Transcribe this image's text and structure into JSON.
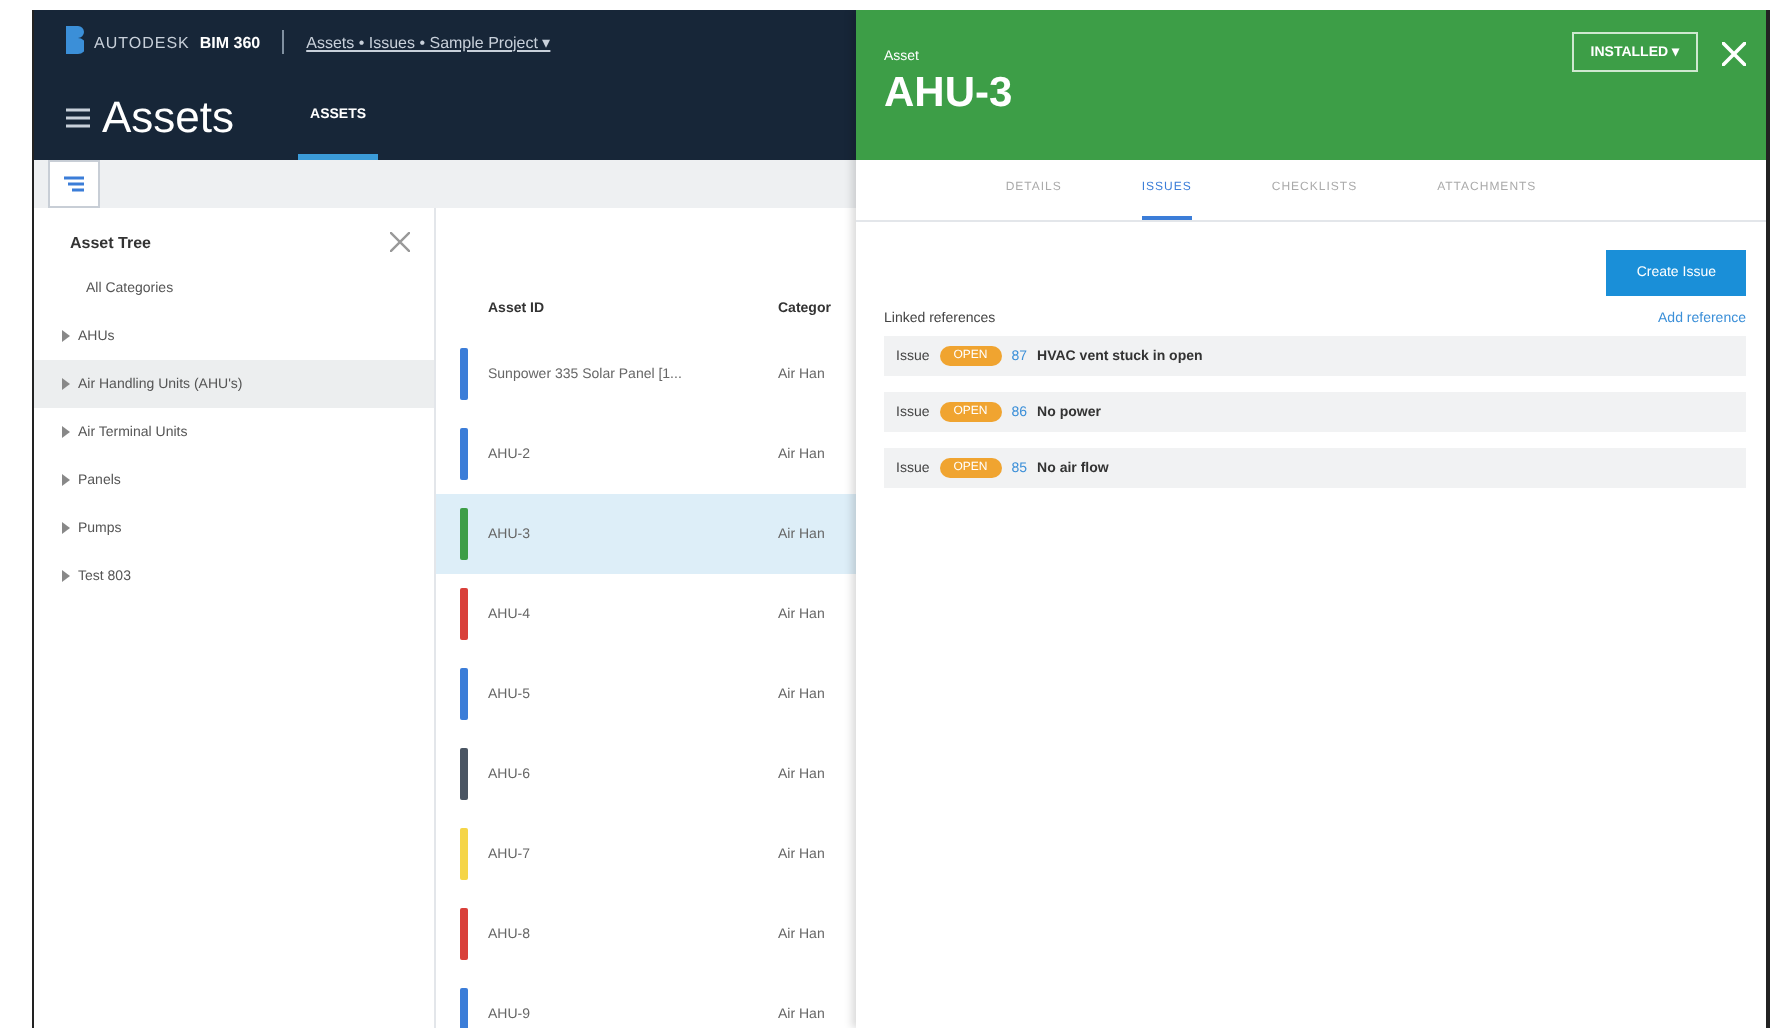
{
  "brand": {
    "logo": "AUTODESK",
    "product": "BIM 360"
  },
  "breadcrumb": "Assets • Issues • Sample Project ▾",
  "page_title": "Assets",
  "nav_tabs": [
    {
      "label": "ASSETS",
      "selected": true
    }
  ],
  "asset_tree": {
    "title": "Asset Tree",
    "items": [
      {
        "label": "All Categories",
        "kind": "root",
        "selected": false
      },
      {
        "label": "AHUs",
        "kind": "group",
        "expanded": false,
        "selected": false
      },
      {
        "label": "Air Handling Units (AHU's)",
        "kind": "group",
        "expanded": false,
        "selected": true
      },
      {
        "label": "Air Terminal Units",
        "kind": "group",
        "expanded": false,
        "selected": false
      },
      {
        "label": "Panels",
        "kind": "group",
        "expanded": false,
        "selected": false
      },
      {
        "label": "Pumps",
        "kind": "group",
        "expanded": false,
        "selected": false
      },
      {
        "label": "Test 803",
        "kind": "group",
        "expanded": false,
        "selected": false
      }
    ]
  },
  "table": {
    "columns": [
      "Asset ID",
      "Categor"
    ],
    "rows": [
      {
        "cells": [
          "Sunpower 335 Solar Panel [1...",
          "Air Han"
        ],
        "color": "#3b7dd8",
        "selected": false
      },
      {
        "cells": [
          "AHU-2",
          "Air Han"
        ],
        "color": "#3b7dd8",
        "selected": false
      },
      {
        "cells": [
          "AHU-3",
          "Air Han"
        ],
        "color": "#3d9e47",
        "selected": true
      },
      {
        "cells": [
          "AHU-4",
          "Air Han"
        ],
        "color": "#d9403a",
        "selected": false
      },
      {
        "cells": [
          "AHU-5",
          "Air Han"
        ],
        "color": "#3b7dd8",
        "selected": false
      },
      {
        "cells": [
          "AHU-6",
          "Air Han"
        ],
        "color": "#4a5563",
        "selected": false
      },
      {
        "cells": [
          "AHU-7",
          "Air Han"
        ],
        "color": "#f5d547",
        "selected": false
      },
      {
        "cells": [
          "AHU-8",
          "Air Han"
        ],
        "color": "#d9403a",
        "selected": false
      },
      {
        "cells": [
          "AHU-9",
          "Air Han"
        ],
        "color": "#3b7dd8",
        "selected": false
      }
    ]
  },
  "panel": {
    "kicker": "Asset",
    "title": "AHU-3",
    "status": "INSTALLED ▾",
    "tabs": [
      {
        "label": "DETAILS",
        "selected": false
      },
      {
        "label": "ISSUES",
        "selected": true
      },
      {
        "label": "CHECKLISTS",
        "selected": false
      },
      {
        "label": "ATTACHMENTS",
        "selected": false
      }
    ],
    "create_button": "Create Issue",
    "section_title": "Linked references",
    "add_link": "Add reference",
    "references": [
      {
        "type": "Issue",
        "badge": "OPEN",
        "number": "87",
        "title": "HVAC vent stuck in open"
      },
      {
        "type": "Issue",
        "badge": "OPEN",
        "number": "86",
        "title": "No power"
      },
      {
        "type": "Issue",
        "badge": "OPEN",
        "number": "85",
        "title": "No air flow"
      }
    ]
  }
}
